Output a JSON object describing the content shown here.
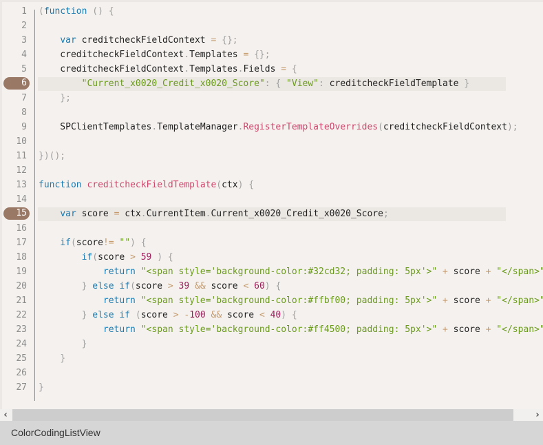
{
  "editor": {
    "highlighted_lines": [
      6,
      15
    ],
    "lines": [
      {
        "n": "1",
        "tokens": [
          [
            "pn",
            "("
          ],
          [
            "kw",
            "function"
          ],
          [
            "tx",
            " "
          ],
          [
            "pn",
            "()"
          ],
          [
            "tx",
            " "
          ],
          [
            "pn",
            "{"
          ]
        ]
      },
      {
        "n": "2",
        "tokens": []
      },
      {
        "n": "3",
        "tokens": [
          [
            "tx",
            "    "
          ],
          [
            "kw",
            "var"
          ],
          [
            "tx",
            " creditcheckFieldContext "
          ],
          [
            "op",
            "="
          ],
          [
            "tx",
            " "
          ],
          [
            "pn",
            "{};"
          ]
        ]
      },
      {
        "n": "4",
        "tokens": [
          [
            "tx",
            "    creditcheckFieldContext"
          ],
          [
            "pn",
            "."
          ],
          [
            "tx",
            "Templates "
          ],
          [
            "op",
            "="
          ],
          [
            "tx",
            " "
          ],
          [
            "pn",
            "{};"
          ]
        ]
      },
      {
        "n": "5",
        "tokens": [
          [
            "tx",
            "    creditcheckFieldContext"
          ],
          [
            "pn",
            "."
          ],
          [
            "tx",
            "Templates"
          ],
          [
            "pn",
            "."
          ],
          [
            "tx",
            "Fields "
          ],
          [
            "op",
            "="
          ],
          [
            "tx",
            " "
          ],
          [
            "pn",
            "{"
          ]
        ]
      },
      {
        "n": "6",
        "tokens": [
          [
            "tx",
            "        "
          ],
          [
            "str",
            "\"Current_x0020_Credit_x0020_Score\""
          ],
          [
            "pn",
            ":"
          ],
          [
            "tx",
            " "
          ],
          [
            "pn",
            "{"
          ],
          [
            "tx",
            " "
          ],
          [
            "str",
            "\"View\""
          ],
          [
            "pn",
            ":"
          ],
          [
            "tx",
            " creditcheckFieldTemplate "
          ],
          [
            "pn",
            "}"
          ]
        ]
      },
      {
        "n": "7",
        "tokens": [
          [
            "tx",
            "    "
          ],
          [
            "pn",
            "};"
          ]
        ]
      },
      {
        "n": "8",
        "tokens": []
      },
      {
        "n": "9",
        "tokens": [
          [
            "tx",
            "    SPClientTemplates"
          ],
          [
            "pn",
            "."
          ],
          [
            "tx",
            "TemplateManager"
          ],
          [
            "pn",
            "."
          ],
          [
            "fn",
            "RegisterTemplateOverrides"
          ],
          [
            "pn",
            "("
          ],
          [
            "tx",
            "creditcheckFieldContext"
          ],
          [
            "pn",
            ");"
          ]
        ]
      },
      {
        "n": "10",
        "tokens": []
      },
      {
        "n": "11",
        "tokens": [
          [
            "pn",
            "})();"
          ]
        ]
      },
      {
        "n": "12",
        "tokens": []
      },
      {
        "n": "13",
        "tokens": [
          [
            "kw",
            "function"
          ],
          [
            "tx",
            " "
          ],
          [
            "fn",
            "creditcheckFieldTemplate"
          ],
          [
            "pn",
            "("
          ],
          [
            "tx",
            "ctx"
          ],
          [
            "pn",
            ")"
          ],
          [
            "tx",
            " "
          ],
          [
            "pn",
            "{"
          ]
        ]
      },
      {
        "n": "14",
        "tokens": []
      },
      {
        "n": "15",
        "tokens": [
          [
            "tx",
            "    "
          ],
          [
            "kw",
            "var"
          ],
          [
            "tx",
            " score "
          ],
          [
            "op",
            "="
          ],
          [
            "tx",
            " ctx"
          ],
          [
            "pn",
            "."
          ],
          [
            "tx",
            "CurrentItem"
          ],
          [
            "pn",
            "."
          ],
          [
            "tx",
            "Current_x0020_Credit_x0020_Score"
          ],
          [
            "pn",
            ";"
          ]
        ]
      },
      {
        "n": "16",
        "tokens": []
      },
      {
        "n": "17",
        "tokens": [
          [
            "tx",
            "    "
          ],
          [
            "kw",
            "if"
          ],
          [
            "pn",
            "("
          ],
          [
            "tx",
            "score"
          ],
          [
            "op",
            "!="
          ],
          [
            "tx",
            " "
          ],
          [
            "str",
            "\"\""
          ],
          [
            "pn",
            ")"
          ],
          [
            "tx",
            " "
          ],
          [
            "pn",
            "{"
          ]
        ]
      },
      {
        "n": "18",
        "tokens": [
          [
            "tx",
            "        "
          ],
          [
            "kw",
            "if"
          ],
          [
            "pn",
            "("
          ],
          [
            "tx",
            "score "
          ],
          [
            "op",
            ">"
          ],
          [
            "tx",
            " "
          ],
          [
            "num",
            "59"
          ],
          [
            "tx",
            " "
          ],
          [
            "pn",
            ")"
          ],
          [
            "tx",
            " "
          ],
          [
            "pn",
            "{"
          ]
        ]
      },
      {
        "n": "19",
        "tokens": [
          [
            "tx",
            "            "
          ],
          [
            "kw",
            "return"
          ],
          [
            "tx",
            " "
          ],
          [
            "str",
            "\"<span style='background-color:#32cd32; padding: 5px'>\""
          ],
          [
            "tx",
            " "
          ],
          [
            "op",
            "+"
          ],
          [
            "tx",
            " score "
          ],
          [
            "op",
            "+"
          ],
          [
            "tx",
            " "
          ],
          [
            "str",
            "\"</span>\""
          ]
        ]
      },
      {
        "n": "20",
        "tokens": [
          [
            "tx",
            "        "
          ],
          [
            "pn",
            "}"
          ],
          [
            "tx",
            " "
          ],
          [
            "kw",
            "else if"
          ],
          [
            "pn",
            "("
          ],
          [
            "tx",
            "score "
          ],
          [
            "op",
            ">"
          ],
          [
            "tx",
            " "
          ],
          [
            "num",
            "39"
          ],
          [
            "tx",
            " "
          ],
          [
            "op",
            "&&"
          ],
          [
            "tx",
            " score "
          ],
          [
            "op",
            "<"
          ],
          [
            "tx",
            " "
          ],
          [
            "num",
            "60"
          ],
          [
            "pn",
            ")"
          ],
          [
            "tx",
            " "
          ],
          [
            "pn",
            "{"
          ]
        ]
      },
      {
        "n": "21",
        "tokens": [
          [
            "tx",
            "            "
          ],
          [
            "kw",
            "return"
          ],
          [
            "tx",
            " "
          ],
          [
            "str",
            "\"<span style='background-color:#ffbf00; padding: 5px'>\""
          ],
          [
            "tx",
            " "
          ],
          [
            "op",
            "+"
          ],
          [
            "tx",
            " score "
          ],
          [
            "op",
            "+"
          ],
          [
            "tx",
            " "
          ],
          [
            "str",
            "\"</span>\""
          ]
        ]
      },
      {
        "n": "22",
        "tokens": [
          [
            "tx",
            "        "
          ],
          [
            "pn",
            "}"
          ],
          [
            "tx",
            " "
          ],
          [
            "kw",
            "else if"
          ],
          [
            "tx",
            " "
          ],
          [
            "pn",
            "("
          ],
          [
            "tx",
            "score "
          ],
          [
            "op",
            ">"
          ],
          [
            "tx",
            " "
          ],
          [
            "op",
            "-"
          ],
          [
            "num",
            "100"
          ],
          [
            "tx",
            " "
          ],
          [
            "op",
            "&&"
          ],
          [
            "tx",
            " score "
          ],
          [
            "op",
            "<"
          ],
          [
            "tx",
            " "
          ],
          [
            "num",
            "40"
          ],
          [
            "pn",
            ")"
          ],
          [
            "tx",
            " "
          ],
          [
            "pn",
            "{"
          ]
        ]
      },
      {
        "n": "23",
        "tokens": [
          [
            "tx",
            "            "
          ],
          [
            "kw",
            "return"
          ],
          [
            "tx",
            " "
          ],
          [
            "str",
            "\"<span style='background-color:#ff4500; padding: 5px'>\""
          ],
          [
            "tx",
            " "
          ],
          [
            "op",
            "+"
          ],
          [
            "tx",
            " score "
          ],
          [
            "op",
            "+"
          ],
          [
            "tx",
            " "
          ],
          [
            "str",
            "\"</span>\""
          ]
        ]
      },
      {
        "n": "24",
        "tokens": [
          [
            "tx",
            "        "
          ],
          [
            "pn",
            "}"
          ]
        ]
      },
      {
        "n": "25",
        "tokens": [
          [
            "tx",
            "    "
          ],
          [
            "pn",
            "}"
          ]
        ]
      },
      {
        "n": "26",
        "tokens": []
      },
      {
        "n": "27",
        "tokens": [
          [
            "pn",
            "}"
          ]
        ]
      }
    ]
  },
  "scrollbar": {
    "left_arrow": "‹",
    "right_arrow": "›",
    "left_icon": "chevron-left-icon",
    "right_icon": "chevron-right-icon"
  },
  "footer": {
    "caption": "ColorCodingListView"
  }
}
